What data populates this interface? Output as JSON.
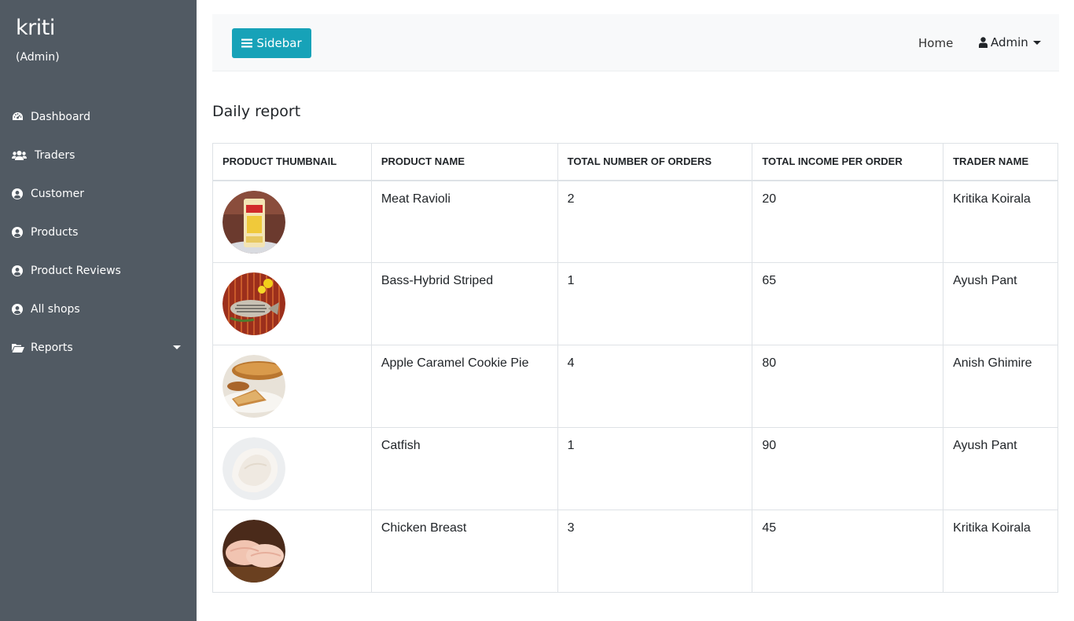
{
  "brand": {
    "name": "kriti",
    "role": "(Admin)"
  },
  "sidebar": {
    "items": [
      {
        "label": "Dashboard",
        "icon": "dashboard-icon"
      },
      {
        "label": "Traders",
        "icon": "users-icon"
      },
      {
        "label": "Customer",
        "icon": "user-circle-icon"
      },
      {
        "label": "Products",
        "icon": "user-circle-icon"
      },
      {
        "label": "Product Reviews",
        "icon": "user-circle-icon"
      },
      {
        "label": "All shops",
        "icon": "user-circle-icon"
      },
      {
        "label": "Reports",
        "icon": "folder-open-icon"
      }
    ]
  },
  "topbar": {
    "sidebar_button": "Sidebar",
    "home": "Home",
    "admin": "Admin"
  },
  "page": {
    "title": "Daily report"
  },
  "table": {
    "headers": [
      "PRODUCT THUMBNAIL",
      "PRODUCT NAME",
      "TOTAL NUMBER OF ORDERS",
      "TOTAL INCOME PER ORDER",
      "TRADER NAME"
    ],
    "rows": [
      {
        "name": "Meat Ravioli",
        "orders": "2",
        "income": "20",
        "trader": "Kritika Koirala",
        "thumb": "ravioli-package"
      },
      {
        "name": "Bass-Hybrid Striped",
        "orders": "1",
        "income": "65",
        "trader": "Ayush Pant",
        "thumb": "striped-bass-fish"
      },
      {
        "name": "Apple Caramel Cookie Pie",
        "orders": "4",
        "income": "80",
        "trader": "Anish Ghimire",
        "thumb": "apple-pie"
      },
      {
        "name": "Catfish",
        "orders": "1",
        "income": "90",
        "trader": "Ayush Pant",
        "thumb": "catfish-fillet"
      },
      {
        "name": "Chicken Breast",
        "orders": "3",
        "income": "45",
        "trader": "Kritika Koirala",
        "thumb": "chicken-breast"
      }
    ]
  },
  "colors": {
    "sidebar": "#515a63",
    "accent": "#17a2b8",
    "topbar": "#f8f9fa"
  }
}
